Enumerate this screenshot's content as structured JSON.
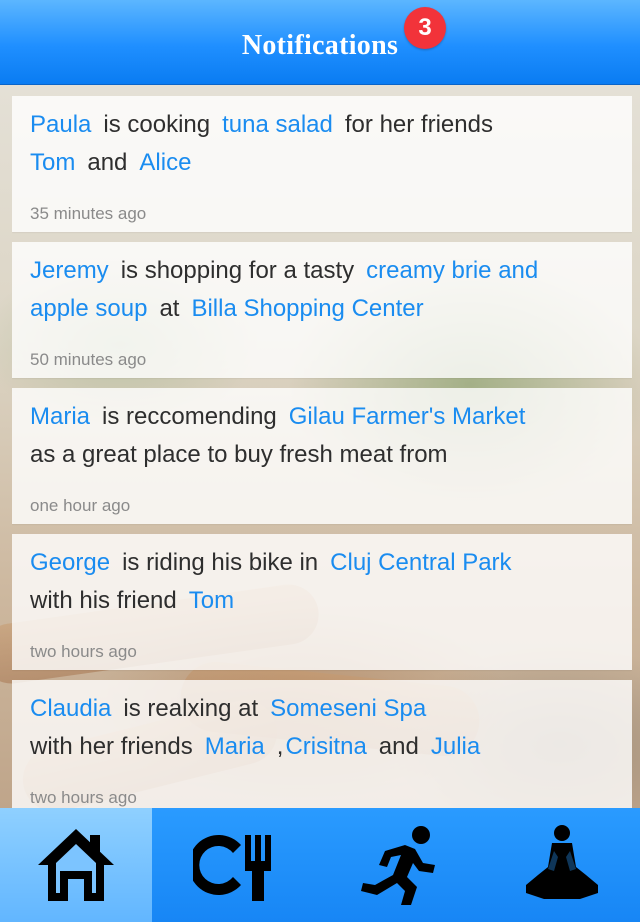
{
  "header": {
    "title": "Notifications",
    "badge_count": "3"
  },
  "notifications": [
    {
      "line1": [
        {
          "text": "Paula",
          "link": true
        },
        {
          "text": "is cooking",
          "link": false
        },
        {
          "text": "tuna salad",
          "link": true
        },
        {
          "text": "for her friends",
          "link": false
        }
      ],
      "line2": [
        {
          "text": "Tom",
          "link": true
        },
        {
          "text": "and",
          "link": false
        },
        {
          "text": "Alice",
          "link": true
        }
      ],
      "time": "35 minutes ago"
    },
    {
      "line1": [
        {
          "text": "Jeremy",
          "link": true
        },
        {
          "text": "is shopping for a tasty",
          "link": false
        },
        {
          "text": "creamy brie and",
          "link": true
        }
      ],
      "line2": [
        {
          "text": "apple soup",
          "link": true
        },
        {
          "text": "at",
          "link": false
        },
        {
          "text": "Billa Shopping Center",
          "link": true
        }
      ],
      "time": "50 minutes ago"
    },
    {
      "line1": [
        {
          "text": "Maria",
          "link": true
        },
        {
          "text": "is reccomending",
          "link": false
        },
        {
          "text": "Gilau Farmer's Market",
          "link": true
        }
      ],
      "line2": [
        {
          "text": "as a great place to buy fresh meat from",
          "link": false
        }
      ],
      "time": "one hour ago"
    },
    {
      "line1": [
        {
          "text": "George",
          "link": true
        },
        {
          "text": "is riding his bike in",
          "link": false
        },
        {
          "text": "Cluj Central Park",
          "link": true
        }
      ],
      "line2": [
        {
          "text": "with his friend",
          "link": false
        },
        {
          "text": "Tom",
          "link": true
        }
      ],
      "time": "two hours ago"
    },
    {
      "line1": [
        {
          "text": "Claudia",
          "link": true
        },
        {
          "text": "is realxing at",
          "link": false
        },
        {
          "text": "Someseni Spa",
          "link": true
        }
      ],
      "line2": [
        {
          "text": "with her friends",
          "link": false
        },
        {
          "text": "Maria",
          "link": true
        },
        {
          "text": ",",
          "link": false
        },
        {
          "text": "Crisitna",
          "link": true
        },
        {
          "text": "and",
          "link": false
        },
        {
          "text": "Julia",
          "link": true
        }
      ],
      "time": "two hours ago"
    }
  ],
  "tabbar": {
    "tabs": [
      {
        "icon": "home-icon",
        "active": true
      },
      {
        "icon": "restaurant-icon",
        "active": false
      },
      {
        "icon": "running-icon",
        "active": false
      },
      {
        "icon": "meditation-icon",
        "active": false
      }
    ]
  },
  "colors": {
    "accent": "#1a8cf0",
    "header": "#1f8fff",
    "badge": "#f2333a"
  }
}
